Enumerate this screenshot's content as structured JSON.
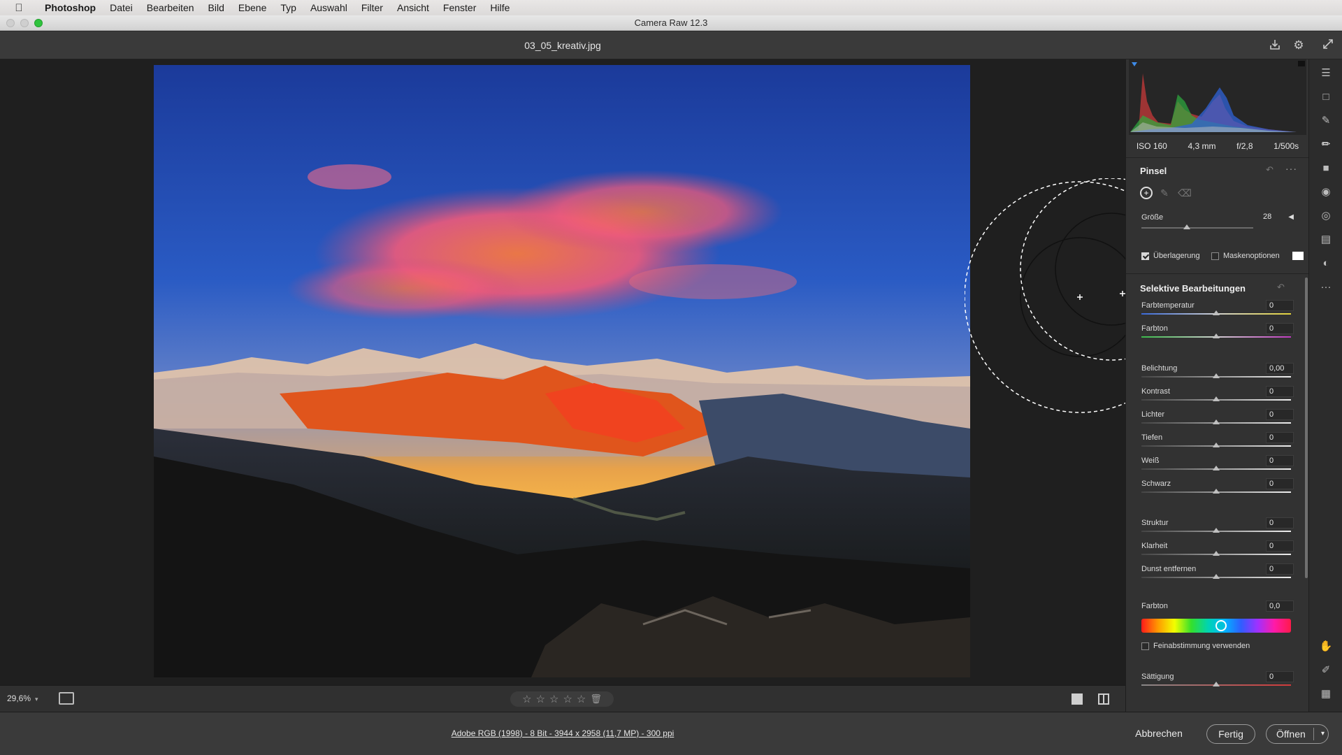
{
  "menubar": {
    "items": [
      "Photoshop",
      "Datei",
      "Bearbeiten",
      "Bild",
      "Ebene",
      "Typ",
      "Auswahl",
      "Filter",
      "Ansicht",
      "Fenster",
      "Hilfe"
    ]
  },
  "window": {
    "title": "Camera Raw 12.3"
  },
  "file": {
    "name": "03_05_kreativ.jpg"
  },
  "canvas": {
    "zoom": "29,6%"
  },
  "rating": {
    "stars": 0,
    "max": 5
  },
  "footer": {
    "info": "Adobe RGB (1998) - 8 Bit - 3944 x 2958 (11,7 MP) - 300 ppi",
    "cancel": "Abbrechen",
    "done": "Fertig",
    "open": "Öffnen"
  },
  "exif": {
    "iso": "ISO 160",
    "focal": "4,3 mm",
    "aperture": "f/2,8",
    "shutter": "1/500s"
  },
  "brush": {
    "title": "Pinsel",
    "size_label": "Größe",
    "size_value": "28",
    "overlay_label": "Überlagerung",
    "overlay_checked": true,
    "mask_label": "Maskenoptionen",
    "mask_checked": false
  },
  "selective": {
    "title": "Selektive Bearbeitungen",
    "sliders": [
      {
        "label": "Farbtemperatur",
        "value": "0"
      },
      {
        "label": "Farbton",
        "value": "0"
      },
      {
        "label": "Belichtung",
        "value": "0,00"
      },
      {
        "label": "Kontrast",
        "value": "0"
      },
      {
        "label": "Lichter",
        "value": "0"
      },
      {
        "label": "Tiefen",
        "value": "0"
      },
      {
        "label": "Weiß",
        "value": "0"
      },
      {
        "label": "Schwarz",
        "value": "0"
      },
      {
        "label": "Struktur",
        "value": "0"
      },
      {
        "label": "Klarheit",
        "value": "0"
      },
      {
        "label": "Dunst entfernen",
        "value": "0"
      }
    ],
    "hue_label": "Farbton",
    "hue_value": "0,0",
    "fine_tune_label": "Feinabstimmung verwenden",
    "fine_tune_checked": false,
    "saturation_label": "Sättigung",
    "saturation_value": "0"
  },
  "colors": {
    "panel": "#323232",
    "canvas": "#1f1f1f",
    "accent_green": "#2fc33d"
  }
}
